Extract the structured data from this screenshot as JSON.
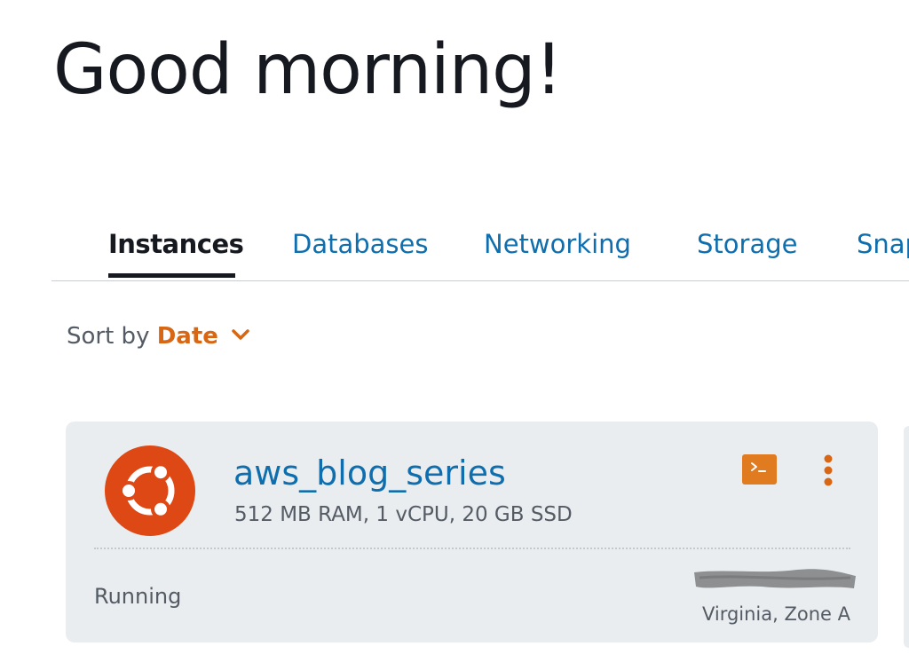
{
  "greeting": "Good morning!",
  "tabs": [
    {
      "label": "Instances",
      "active": true
    },
    {
      "label": "Databases",
      "active": false
    },
    {
      "label": "Networking",
      "active": false
    },
    {
      "label": "Storage",
      "active": false
    },
    {
      "label": "Snapshots",
      "active": false
    }
  ],
  "sort": {
    "prefix": "Sort by",
    "value": "Date",
    "icon": "chevron-down-icon"
  },
  "instance": {
    "name": "aws_blog_series",
    "specs": "512 MB RAM, 1 vCPU, 20 GB SSD",
    "os_icon": "ubuntu-logo-icon",
    "status": "Running",
    "location": "Virginia, Zone A",
    "actions": {
      "connect_icon": "terminal-icon",
      "menu_icon": "vertical-dots-icon"
    }
  },
  "colors": {
    "accent": "#d86613",
    "link": "#0f6ead",
    "text_dark": "#16191f",
    "text_muted": "#545b64",
    "card_bg": "#eaedf0",
    "ubuntu_orange": "#dd4814"
  }
}
